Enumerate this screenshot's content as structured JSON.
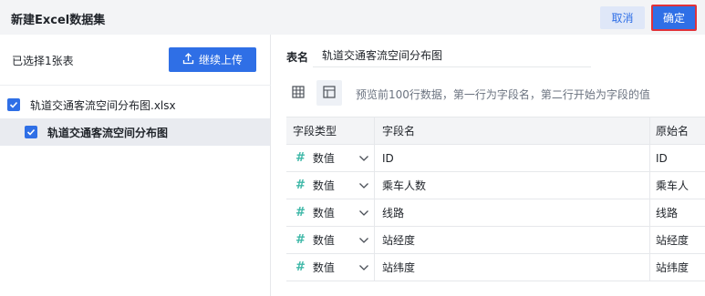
{
  "dialog": {
    "title": "新建Excel数据集",
    "cancel_label": "取消",
    "confirm_label": "确定"
  },
  "left_panel": {
    "selected_count": "已选择1张表",
    "upload_label": "继续上传",
    "file_name": "轨道交通客流空间分布图.xlsx",
    "sheet_name": "轨道交通客流空间分布图"
  },
  "right_panel": {
    "table_name_label": "表名",
    "table_name_value": "轨道交通客流空间分布图",
    "preview_hint": "预览前100行数据，第一行为字段名，第二行开始为字段的值",
    "columns": {
      "type": "字段类型",
      "name": "字段名",
      "original": "原始名"
    },
    "rows": [
      {
        "type": "数值",
        "name": "ID",
        "original": "ID"
      },
      {
        "type": "数值",
        "name": "乘车人数",
        "original": "乘车人"
      },
      {
        "type": "数值",
        "name": "线路",
        "original": "线路"
      },
      {
        "type": "数值",
        "name": "站经度",
        "original": "站经度"
      },
      {
        "type": "数值",
        "name": "站纬度",
        "original": "站纬度"
      }
    ]
  },
  "colors": {
    "primary": "#2f6fe6",
    "number_type_icon": "#3fb8a8",
    "confirm_outline": "#e0323a"
  },
  "icons": [
    "upload-icon",
    "checkbox-checked-icon",
    "grid-view-icon",
    "layout-view-icon",
    "number-type-icon",
    "chevron-down-icon"
  ]
}
